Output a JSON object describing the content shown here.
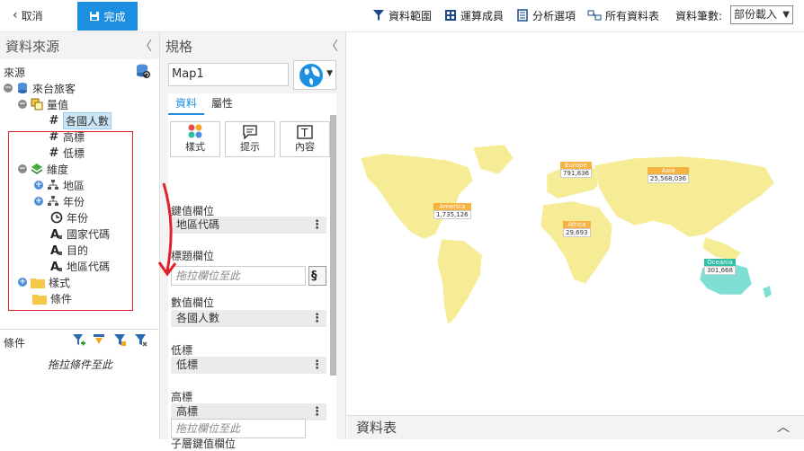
{
  "toolbar": {
    "cancel_label": "取消",
    "done_label": "完成",
    "data_range_label": "資料範圍",
    "calc_member_label": "運算成員",
    "analysis_options_label": "分析選項",
    "all_tables_label": "所有資料表",
    "data_count_label": "資料筆數:",
    "data_count_value": "部份載入"
  },
  "left_panel": {
    "title": "資料來源",
    "source_label": "來源",
    "tree": {
      "root": "來台旅客",
      "measures_folder": "量值",
      "measures": [
        "各國人數",
        "高標",
        "低標"
      ],
      "dimensions_folder": "維度",
      "dimensions": [
        "地區",
        "年份",
        "年份",
        "國家代碼",
        "目的",
        "地區代碼"
      ],
      "style_folder": "樣式",
      "condition_folder": "條件"
    },
    "conditions_label": "條件",
    "conditions_placeholder": "拖拉條件至此"
  },
  "mid_panel": {
    "title": "規格",
    "map_name": "Map1",
    "tabs": [
      "資料",
      "屬性"
    ],
    "icon_buttons": [
      "樣式",
      "提示",
      "內容"
    ],
    "fields": {
      "key_label": "鍵值欄位",
      "key_value": "地區代碼",
      "title_label": "標題欄位",
      "title_placeholder": "拖拉欄位至此",
      "value_label": "數值欄位",
      "value_value": "各國人數",
      "low_label": "低標",
      "low_value": "低標",
      "high_label": "高標",
      "high_value": "高標",
      "subkey_label": "子層鍵值欄位",
      "subkey_placeholder": "拖拉欄位至此"
    }
  },
  "map": {
    "regions": [
      {
        "name": "Europe",
        "value": "791,836"
      },
      {
        "name": "Asia",
        "value": "25,568,036"
      },
      {
        "name": "America",
        "value": "1,735,126"
      },
      {
        "name": "Africa",
        "value": "29,693"
      },
      {
        "name": "Oceania",
        "value": "301,668"
      }
    ],
    "land_color": "#f7ec96",
    "oceania_color": "#7fdfd4"
  },
  "bottom_bar": {
    "title": "資料表"
  }
}
